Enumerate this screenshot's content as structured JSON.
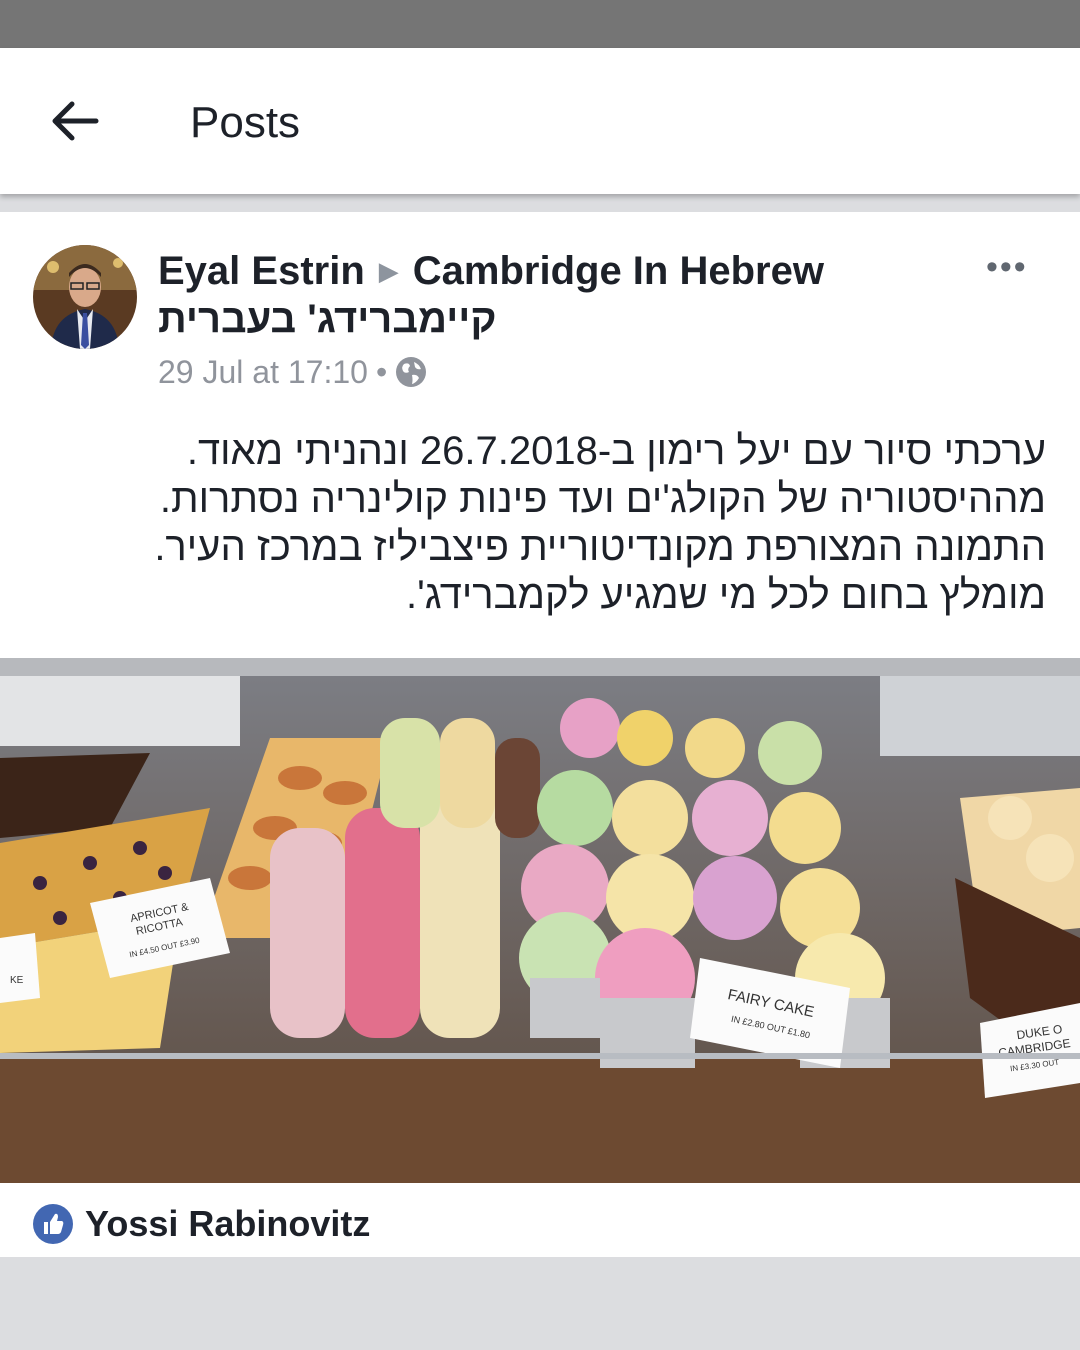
{
  "header": {
    "title": "Posts"
  },
  "post": {
    "author": "Eyal Estrin",
    "group": "Cambridge In Hebrew",
    "group_hebrew": "קיימברידג' בעברית",
    "timestamp": "29 Jul at 17:10",
    "separator": "•",
    "privacy_icon": "globe-icon",
    "body_lines": [
      "ערכתי סיור עם יעל רימון ב-26.7.2018 ונהניתי מאוד.",
      "מההיסטוריה של הקולג'ים ועד פינות קולינריה נסתרות.",
      "התמונה המצורפת מקונדיטוריית פיצביליז במרכז העיר.",
      "מומלץ בחום לכל מי שמגיע לקמברידג'."
    ],
    "more_label": "•••",
    "photo": {
      "labels": {
        "tag1_line1": "APRICOT &",
        "tag1_line2": "RICOTTA",
        "tag1_line3": "IN £4.50  OUT £3.90",
        "tag2_line1": "FAIRY CAKE",
        "tag2_line2": "IN £2.80 OUT £1.80",
        "tag3_line1": "DUKE O",
        "tag3_line2": "CAMBRIDGE",
        "tag3_line3": "IN £3.30  OUT",
        "tag0": "KE"
      }
    },
    "liked_by": "Yossi Rabinovitz"
  },
  "colors": {
    "status_bar": "#757575",
    "like_blue": "#4267b2",
    "text": "#1d2129",
    "meta": "#90949c"
  }
}
